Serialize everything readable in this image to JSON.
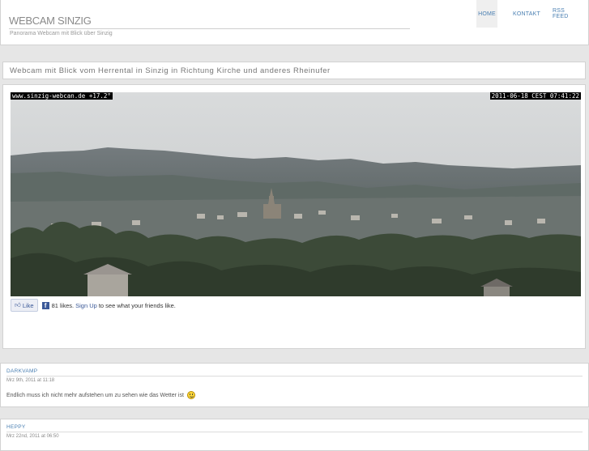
{
  "header": {
    "site_title": "WEBCAM SINZIG",
    "tagline": "Panorama Webcam mit Blick über Sinzig",
    "nav": {
      "home": "HOME",
      "kontakt": "KONTAKT",
      "rss": "RSS FEED"
    }
  },
  "post": {
    "title": "Webcam mit Blick vom Herrental in Sinzig in Richtung Kirche und anderes Rheinufer"
  },
  "webcam": {
    "stamp_left": "www.sinzig-webcan.de +17.2°",
    "stamp_right": "2011-06-18 CEST 07:41:22"
  },
  "facebook": {
    "like_label": "Like",
    "likes_count_text": "81 likes.",
    "signup_label": "Sign Up",
    "suffix_text": "to see what your friends like."
  },
  "comments": [
    {
      "author": "DARKVAMP",
      "date": "Mrz 9th, 2011 at 11:18",
      "text": "Endlich muss ich nicht mehr aufstehen um zu sehen wie das Wetter ist"
    },
    {
      "author": "HEPPY",
      "date": "Mrz 22nd, 2011 at 06:50"
    }
  ],
  "colors": {
    "link_blue": "#4a7fb2",
    "facebook_blue": "#3b5998",
    "page_bg": "#e6e6e6"
  }
}
